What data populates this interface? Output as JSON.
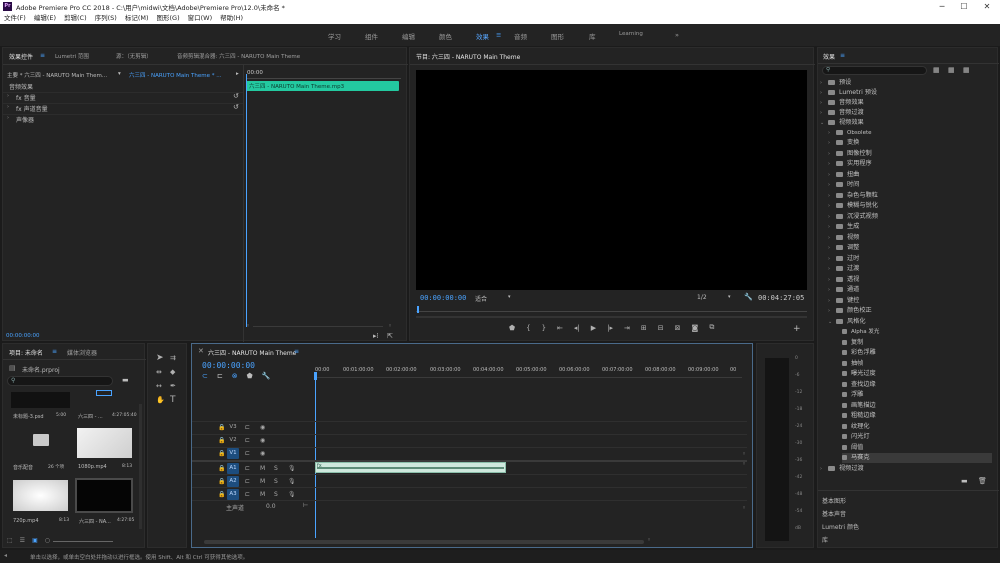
{
  "window": {
    "title": "Adobe Premiere Pro CC 2018 - C:\\用户\\midwi\\文档\\Adobe\\Premiere Pro\\12.0\\未命名 *",
    "logo_text": "Pr",
    "minimize": "─",
    "maximize": "☐",
    "close": "✕"
  },
  "menu": [
    "文件(F)",
    "编辑(E)",
    "剪辑(C)",
    "序列(S)",
    "标记(M)",
    "图形(G)",
    "窗口(W)",
    "帮助(H)"
  ],
  "workspaces": [
    "学习",
    "组件",
    "编辑",
    "颜色",
    "效果",
    "音频",
    "图形",
    "库",
    "Learning",
    "»"
  ],
  "workspace_active": "效果",
  "source_panel": {
    "tabs": [
      "效果控件",
      "Lumetri 范围",
      "源：（无剪辑）",
      "音频剪辑混合器: 六三四 - NARUTO Main Theme"
    ],
    "menu_icon": "≡",
    "clip_path": "主要 * 六三四 - NARUTO Main Them...",
    "clip_seq": "六三四 - NARUTO Main Theme * ...",
    "section": "音频效果",
    "effects": [
      "fx 音量",
      "fx 声道音量",
      "声像器"
    ],
    "mini_timecode": "00:00",
    "clip_name": "六三四 - NARUTO Main Theme.mp3",
    "bottom_timecode": "00:00:00:00"
  },
  "program_panel": {
    "title": "节目: 六三四 - NARUTO Main Theme",
    "timecode": "00:00:00:00",
    "fit": "适合",
    "resolution": "1/2",
    "duration": "00:04:27:05"
  },
  "project_panel": {
    "tabs": [
      "项目: 未命名",
      "媒体浏览器"
    ],
    "project_file": "未命名.prproj",
    "items": [
      {
        "name": "未标题-3.psd",
        "meta": "5:00"
      },
      {
        "name": "六三四 - ...",
        "meta": "4:27:05:40"
      },
      {
        "name": "音乐配音",
        "meta": "26 个项"
      },
      {
        "name": "1080p.mp4",
        "meta": "8:13"
      },
      {
        "name": "720p.mp4",
        "meta": "8:13"
      },
      {
        "name": "六三四 - NA...",
        "meta": "4:27:05"
      }
    ]
  },
  "timeline": {
    "title": "六三四 - NARUTO Main Theme",
    "timecode": "00:00:00:00",
    "ruler": [
      "00:00",
      "00:01:00:00",
      "00:02:00:00",
      "00:03:00:00",
      "00:04:00:00",
      "00:05:00:00",
      "00:06:00:00",
      "00:07:00:00",
      "00:08:00:00",
      "00:09:00:00",
      "00"
    ],
    "video_tracks": [
      "V3",
      "V2",
      "V1"
    ],
    "audio_tracks": [
      "A1",
      "A2",
      "A3"
    ],
    "master": "主声道",
    "master_value": "0.0",
    "track_letters": {
      "m": "M",
      "s": "S"
    }
  },
  "meters": {
    "scale": [
      "0",
      "-6",
      "-12",
      "-18",
      "-24",
      "-30",
      "-36",
      "-42",
      "-48",
      "-54",
      "dB"
    ]
  },
  "effects_panel": {
    "title": "效果",
    "categories": [
      "预设",
      "Lumetri 预设",
      "音频效果",
      "音频过渡",
      "视频效果"
    ],
    "video_sub": [
      "Obsolete",
      "变换",
      "图像控制",
      "实用程序",
      "扭曲",
      "时间",
      "杂色与颗粒",
      "模糊与锐化",
      "沉浸式视频",
      "生成",
      "视频",
      "调整",
      "过时",
      "过渡",
      "透视",
      "通道",
      "键控",
      "颜色校正",
      "风格化"
    ],
    "stylize_items": [
      "Alpha 发光",
      "复制",
      "彩色浮雕",
      "抽帧",
      "曝光过度",
      "查找边缘",
      "浮雕",
      "画笔描边",
      "粗糙边缘",
      "纹理化",
      "闪光灯",
      "阈值",
      "马赛克"
    ],
    "below": [
      "视频过渡",
      "基本图形",
      "基本声音",
      "Lumetri 颜色",
      "库"
    ],
    "side_icons": [
      "▦",
      "▦",
      "▦"
    ]
  },
  "status": {
    "text": "单击以选择，或单击空白处并拖动以进行框选。使用 Shift、Alt 和 Ctrl 可获得其他选项。"
  },
  "colors": {
    "accent": "#4aa3ff",
    "clip_green": "#23c9a0",
    "track_blue": "#1d4d7e"
  }
}
